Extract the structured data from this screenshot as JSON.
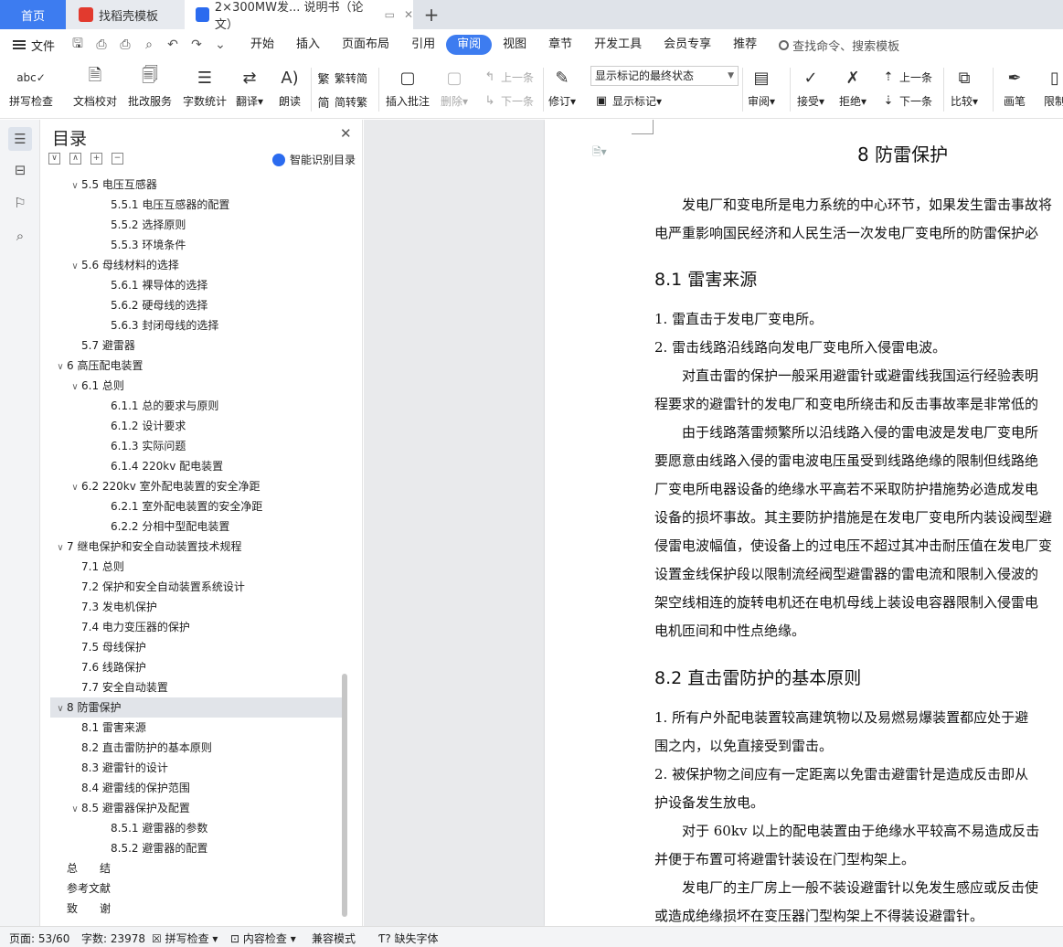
{
  "tabs": {
    "home": "首页",
    "template": "找稻壳模板",
    "doc": "2×300MW发... 说明书（论文）",
    "add": "+"
  },
  "menubar": {
    "file": "文件",
    "items": [
      "开始",
      "插入",
      "页面布局",
      "引用",
      "审阅",
      "视图",
      "章节",
      "开发工具",
      "会员专享",
      "推荐"
    ],
    "active": "审阅",
    "search": "查找命令、搜索模板"
  },
  "toolbar": {
    "spell": "拼写检查",
    "doc_check": "文档校对",
    "batch": "批改服务",
    "word_count": "字数统计",
    "translate": "翻译",
    "read": "朗读",
    "trad": "繁转简",
    "simp": "简转繁",
    "insert_comment": "插入批注",
    "delete": "删除",
    "prev": "上一条",
    "next": "下一条",
    "revise": "修订",
    "show_select": "显示标记的最终状态",
    "show_marks": "显示标记",
    "review": "审阅",
    "accept": "接受",
    "reject": "拒绝",
    "prev2": "上一条",
    "next2": "下一条",
    "compare": "比较",
    "pen": "画笔",
    "limit": "限制"
  },
  "toc": {
    "title": "目录",
    "smart": "智能识别目录",
    "items": [
      {
        "label": "5.5 电压互感器",
        "level": 2,
        "toggle": "∨"
      },
      {
        "label": "5.5.1 电压互感器的配置",
        "level": 3
      },
      {
        "label": "5.5.2 选择原则",
        "level": 3
      },
      {
        "label": "5.5.3 环境条件",
        "level": 3
      },
      {
        "label": "5.6 母线材料的选择",
        "level": 2,
        "toggle": "∨"
      },
      {
        "label": "5.6.1 裸导体的选择",
        "level": 3
      },
      {
        "label": "5.6.2 硬母线的选择",
        "level": 3
      },
      {
        "label": "5.6.3 封闭母线的选择",
        "level": 3
      },
      {
        "label": "5.7 避雷器",
        "level": 2
      },
      {
        "label": "6 高压配电装置",
        "level": 1,
        "toggle": "∨"
      },
      {
        "label": "6.1 总则",
        "level": 2,
        "toggle": "∨"
      },
      {
        "label": "6.1.1 总的要求与原则",
        "level": 3
      },
      {
        "label": "6.1.2 设计要求",
        "level": 3
      },
      {
        "label": "6.1.3 实际问题",
        "level": 3
      },
      {
        "label": "6.1.4 220kv 配电装置",
        "level": 3
      },
      {
        "label": "6.2 220kv 室外配电装置的安全净距",
        "level": 2,
        "toggle": "∨"
      },
      {
        "label": "6.2.1 室外配电装置的安全净距",
        "level": 3
      },
      {
        "label": "6.2.2 分相中型配电装置",
        "level": 3
      },
      {
        "label": "7 继电保护和安全自动装置技术规程",
        "level": 1,
        "toggle": "∨"
      },
      {
        "label": "7.1 总则",
        "level": 2
      },
      {
        "label": "7.2 保护和安全自动装置系统设计",
        "level": 2
      },
      {
        "label": "7.3 发电机保护",
        "level": 2
      },
      {
        "label": "7.4 电力变压器的保护",
        "level": 2
      },
      {
        "label": "7.5 母线保护",
        "level": 2
      },
      {
        "label": "7.6 线路保护",
        "level": 2
      },
      {
        "label": "7.7 安全自动装置",
        "level": 2
      },
      {
        "label": "8 防雷保护",
        "level": 1,
        "toggle": "∨",
        "selected": true
      },
      {
        "label": "8.1 雷害来源",
        "level": 2
      },
      {
        "label": "8.2 直击雷防护的基本原则",
        "level": 2
      },
      {
        "label": "8.3 避雷针的设计",
        "level": 2
      },
      {
        "label": "8.4 避雷线的保护范围",
        "level": 2
      },
      {
        "label": "8.5 避雷器保护及配置",
        "level": 2,
        "toggle": "∨"
      },
      {
        "label": "8.5.1 避雷器的参数",
        "level": 3
      },
      {
        "label": "8.5.2 避雷器的配置",
        "level": 3
      },
      {
        "label": "总　　结",
        "level": 1
      },
      {
        "label": "参考文献",
        "level": 1
      },
      {
        "label": "致　　谢",
        "level": 1
      }
    ]
  },
  "document": {
    "lines": [
      {
        "text": "8  防雷保护",
        "kind": "h1"
      },
      {
        "text": "发电厂和变电所是电力系统的中心环节，如果发生雷击事故将",
        "kind": "p"
      },
      {
        "text": "电严重影响国民经济和人民生活一次发电厂变电所的防雷保护必",
        "kind": "p"
      },
      {
        "text": "8.1 雷害来源",
        "kind": "h2"
      },
      {
        "text": "1.   雷直击于发电厂变电所。",
        "kind": "p"
      },
      {
        "text": "2.   雷击线路沿线路向发电厂变电所入侵雷电波。",
        "kind": "p"
      },
      {
        "text": "对直击雷的保护一般采用避雷针或避雷线我国运行经验表明",
        "kind": "p"
      },
      {
        "text": "程要求的避雷针的发电厂和变电所绕击和反击事故率是非常低的",
        "kind": "p"
      },
      {
        "text": "由于线路落雷频繁所以沿线路入侵的雷电波是发电厂变电所",
        "kind": "p"
      },
      {
        "text": "要愿意由线路入侵的雷电波电压虽受到线路绝缘的限制但线路绝",
        "kind": "p"
      },
      {
        "text": "厂变电所电器设备的绝缘水平高若不采取防护措施势必造成发电",
        "kind": "p"
      },
      {
        "text": "设备的损坏事故。其主要防护措施是在发电厂变电所内装设阀型避",
        "kind": "p"
      },
      {
        "text": "侵雷电波幅值，使设备上的过电压不超过其冲击耐压值在发电厂变",
        "kind": "p"
      },
      {
        "text": "设置金线保护段以限制流经阀型避雷器的雷电流和限制入侵波的",
        "kind": "p"
      },
      {
        "text": "架空线相连的旋转电机还在电机母线上装设电容器限制入侵雷电",
        "kind": "p"
      },
      {
        "text": "电机匝间和中性点绝缘。",
        "kind": "p"
      },
      {
        "text": "8.2 直击雷防护的基本原则",
        "kind": "h2"
      },
      {
        "text": "1.   所有户外配电装置较高建筑物以及易燃易爆装置都应处于避",
        "kind": "p"
      },
      {
        "text": "围之内，以免直接受到雷击。",
        "kind": "p"
      },
      {
        "text": "2.   被保护物之间应有一定距离以免雷击避雷针是造成反击即从",
        "kind": "p"
      },
      {
        "text": "护设备发生放电。",
        "kind": "p"
      },
      {
        "text": "对于 60kv 以上的配电装置由于绝缘水平较高不易造成反击",
        "kind": "p"
      },
      {
        "text": "并便于布置可将避雷针装设在门型构架上。",
        "kind": "p"
      },
      {
        "text": "发电厂的主厂房上一般不装设避雷针以免发生感应或反击使",
        "kind": "p"
      },
      {
        "text": "或造成绝缘损坏在变压器门型构架上不得装设避雷针。",
        "kind": "p"
      }
    ]
  },
  "status": {
    "page": "页面: 53/60",
    "words": "字数: 23978",
    "spell": "拼写检查",
    "content": "内容检查",
    "compat": "兼容模式",
    "font_missing": "缺失字体"
  }
}
